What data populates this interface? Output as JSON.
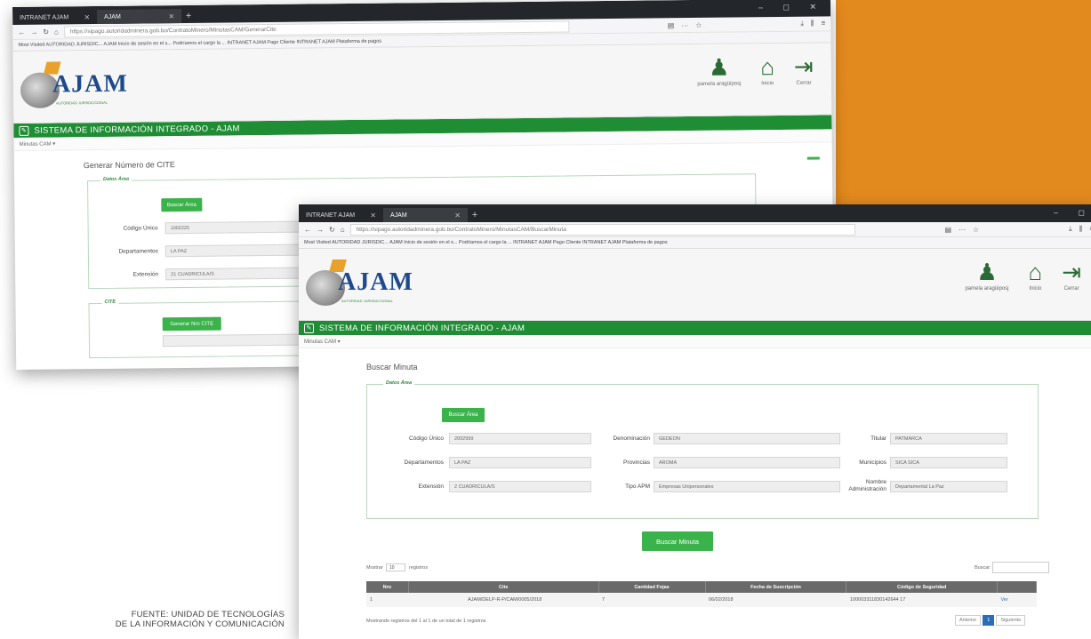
{
  "source_caption": [
    "FUENTE: UNIDAD DE TECNOLOGÍAS",
    "DE LA INFORMACIÓN Y COMUNICACIÓN"
  ],
  "colors": {
    "orange_block": "#e38a1e",
    "green_bar": "#1f8d34",
    "button_green": "#3ab34a"
  },
  "app": {
    "logo_text": "AJAM",
    "logo_tagline": "AUTORIDAD JURISDICCIONAL",
    "system_title": "SISTEMA DE INFORMACIÓN INTEGRADO - AJAM",
    "submenu": "Minutas CAM ▾",
    "header_icons": [
      {
        "name": "user-icon",
        "label": "pamela aragüiposj"
      },
      {
        "name": "home-icon",
        "label": "Inicio"
      },
      {
        "name": "logout-icon",
        "label": "Cerrar"
      }
    ]
  },
  "back_window": {
    "tabs": [
      {
        "label": "INTRANET AJAM"
      },
      {
        "label": "AJAM"
      }
    ],
    "url": "https://sipago.autoridadminera.gob.bo/ContratoMinero/MinutasCAM/GenerarCite",
    "bookmarks": "Most Visited   AUTORIDAD JURISDIC...   AJAM   Inicio de sesión en el s...   Podríamos el cargo la ...   INTRANET AJAM   Pago Cliente   INTRANET AJAM   Plataforma de pagos",
    "page_title": "Generar Número de CITE",
    "fieldset1_legend": "Datos Área",
    "buscar_area": "Buscar Área",
    "fields": [
      {
        "label": "Código Único",
        "value": "1002225"
      },
      {
        "label": "Departamentos",
        "value": "LA PAZ"
      },
      {
        "label": "Extensión",
        "value": "21 CUADRICULA/S"
      }
    ],
    "fieldset2_legend": "CITE",
    "generar_btn": "Generar Nro CITE"
  },
  "front_window": {
    "tabs": [
      {
        "label": "INTRANET AJAM"
      },
      {
        "label": "AJAM"
      }
    ],
    "url": "https://sipago.autoridadminera.gob.bo/ContratoMinero/MinutasCAM/BuscarMinuta",
    "bookmarks": "Most Visited   AUTORIDAD JURISDIC...   AJAM   Inicio de sesión en el s...   Podríamos el cargo la ...   INTRANET AJAM   Pago Cliente   INTRANET AJAM   Plataforma de pagos",
    "page_title": "Buscar Minuta",
    "fieldset_legend": "Datos Área",
    "buscar_area": "Buscar Área",
    "fields": [
      {
        "label": "Código Único",
        "value": "2002999"
      },
      {
        "label": "Denominación",
        "value": "GEDEON"
      },
      {
        "label": "Titular",
        "value": "PATMARCA"
      },
      {
        "label": "Departamentos",
        "value": "LA PAZ"
      },
      {
        "label": "Provincias",
        "value": "AROMA"
      },
      {
        "label": "Municipios",
        "value": "SICA SICA"
      },
      {
        "label": "Extensión",
        "value": "2 CUADRICULA/S"
      },
      {
        "label": "Tipo APM",
        "value": "Empresas Unipersonales"
      },
      {
        "label": "Nombre Administración",
        "value": "Departamental La Paz"
      }
    ],
    "buscar_minuta": "Buscar Minuta",
    "show_prefix": "Mostrar",
    "show_value": "10",
    "show_suffix": "registros",
    "search_label": "Buscar:",
    "table": {
      "headers": [
        "Nro",
        "Cite",
        "Cantidad Fojas",
        "Fecha de Suscripción",
        "Código de Seguridad",
        ""
      ],
      "rows": [
        [
          "1",
          "AJAM/DELP-R-P/CAM/0005/2018",
          "7",
          "06/02/2018",
          "100003311830142644 17",
          "Ver"
        ]
      ]
    },
    "info": "Mostrando registros del 1 al 1 de un total de 1 registros",
    "pager": {
      "prev": "Anterior",
      "page": "1",
      "next": "Siguiente"
    }
  }
}
